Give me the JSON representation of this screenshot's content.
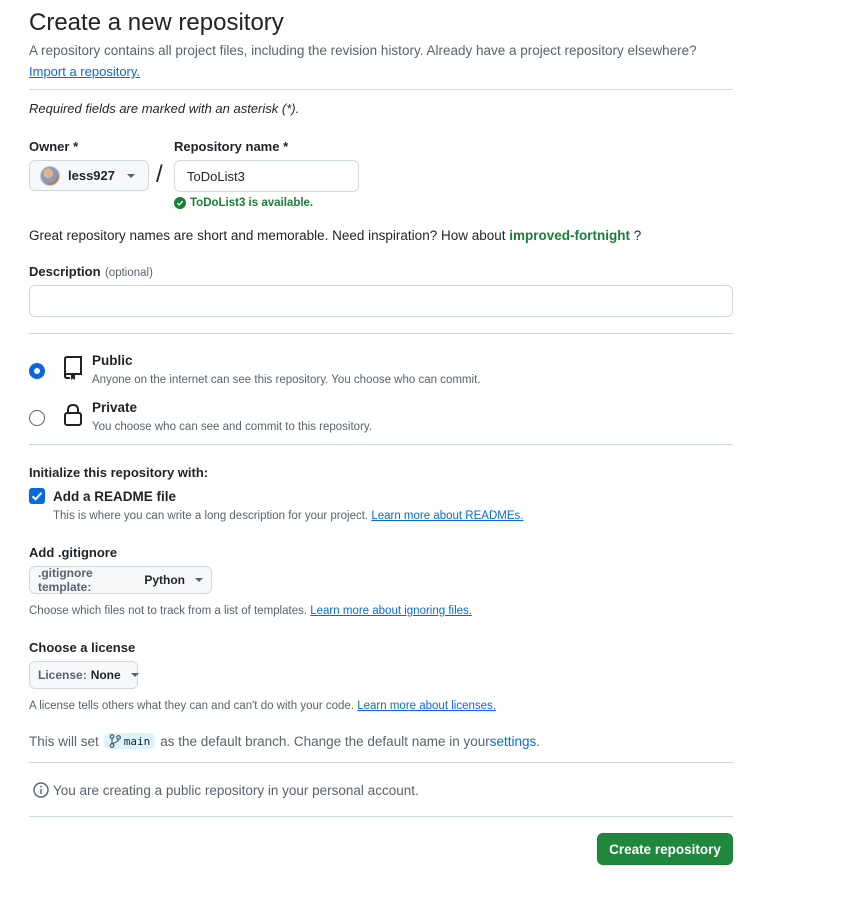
{
  "header": {
    "title": "Create a new repository",
    "subtitle": "A repository contains all project files, including the revision history. Already have a project repository elsewhere?",
    "import_link": "Import a repository."
  },
  "required_note": "Required fields are marked with an asterisk (*).",
  "owner": {
    "label": "Owner *",
    "value": "less927",
    "avatar_icon": "user-avatar"
  },
  "separator": "/",
  "repo_name": {
    "label": "Repository name *",
    "value": "ToDoList3",
    "availability": "ToDoList3 is available.",
    "availability_color": "#1a7f37"
  },
  "suggestion": {
    "text": "Great repository names are short and memorable. Need inspiration? How about",
    "name": "improved-fortnight",
    "end": "?"
  },
  "description": {
    "label": "Description",
    "optional": "(optional)",
    "value": "",
    "placeholder": ""
  },
  "visibility": {
    "selected": "public",
    "public": {
      "label": "Public",
      "desc": "Anyone on the internet can see this repository. You choose who can commit.",
      "icon": "repo-icon"
    },
    "private": {
      "label": "Private",
      "desc": "You choose who can see and commit to this repository.",
      "icon": "lock-icon"
    }
  },
  "init": {
    "heading": "Initialize this repository with:",
    "readme": {
      "label": "Add a README file",
      "checked": true,
      "desc": "This is where you can write a long description for your project.",
      "link": "Learn more about READMEs."
    }
  },
  "gitignore": {
    "heading": "Add .gitignore",
    "button_prefix": ".gitignore template:",
    "button_value": "Python",
    "desc": "Choose which files not to track from a list of templates.",
    "link": "Learn more about ignoring files."
  },
  "license": {
    "heading": "Choose a license",
    "button_prefix": "License:",
    "button_value": "None",
    "desc": "A license tells others what they can and can't do with your code.",
    "link": "Learn more about licenses."
  },
  "branch": {
    "before": "This will set",
    "name": "main",
    "after": "as the default branch. Change the default name in your",
    "link": "settings",
    "end": "."
  },
  "notice": "You are creating a public repository in your personal account.",
  "submit": {
    "label": "Create repository",
    "color": "#1f883d"
  },
  "colors": {
    "accent": "#0969da",
    "success": "#1a7f37",
    "border": "#d1d9e0",
    "muted": "#59636e"
  }
}
